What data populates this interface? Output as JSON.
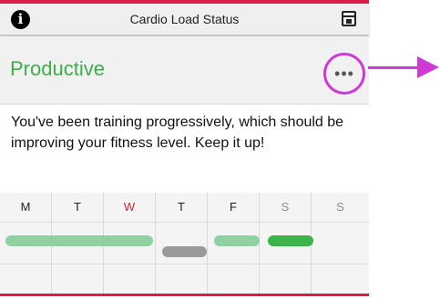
{
  "header": {
    "title": "Cardio Load Status",
    "left_icon": "info-icon",
    "right_icon": "calendar-icon"
  },
  "status": {
    "title": "Productive",
    "title_color": "#3dae4a",
    "more_label": "•••"
  },
  "message": "You've been training progressively, which should be improving your fitness level. Keep it up!",
  "week": {
    "days": [
      {
        "label": "M",
        "state": "past"
      },
      {
        "label": "T",
        "state": "past"
      },
      {
        "label": "W",
        "state": "today"
      },
      {
        "label": "T",
        "state": "past"
      },
      {
        "label": "F",
        "state": "past"
      },
      {
        "label": "S",
        "state": "future"
      },
      {
        "label": "S",
        "state": "future"
      }
    ]
  },
  "colors": {
    "accent_red": "#d51e4a",
    "callout_purple": "#ce3ad6",
    "bar_light_green": "#8fd1a0",
    "bar_gray": "#9a9a9a",
    "bar_green": "#3bb54a"
  }
}
